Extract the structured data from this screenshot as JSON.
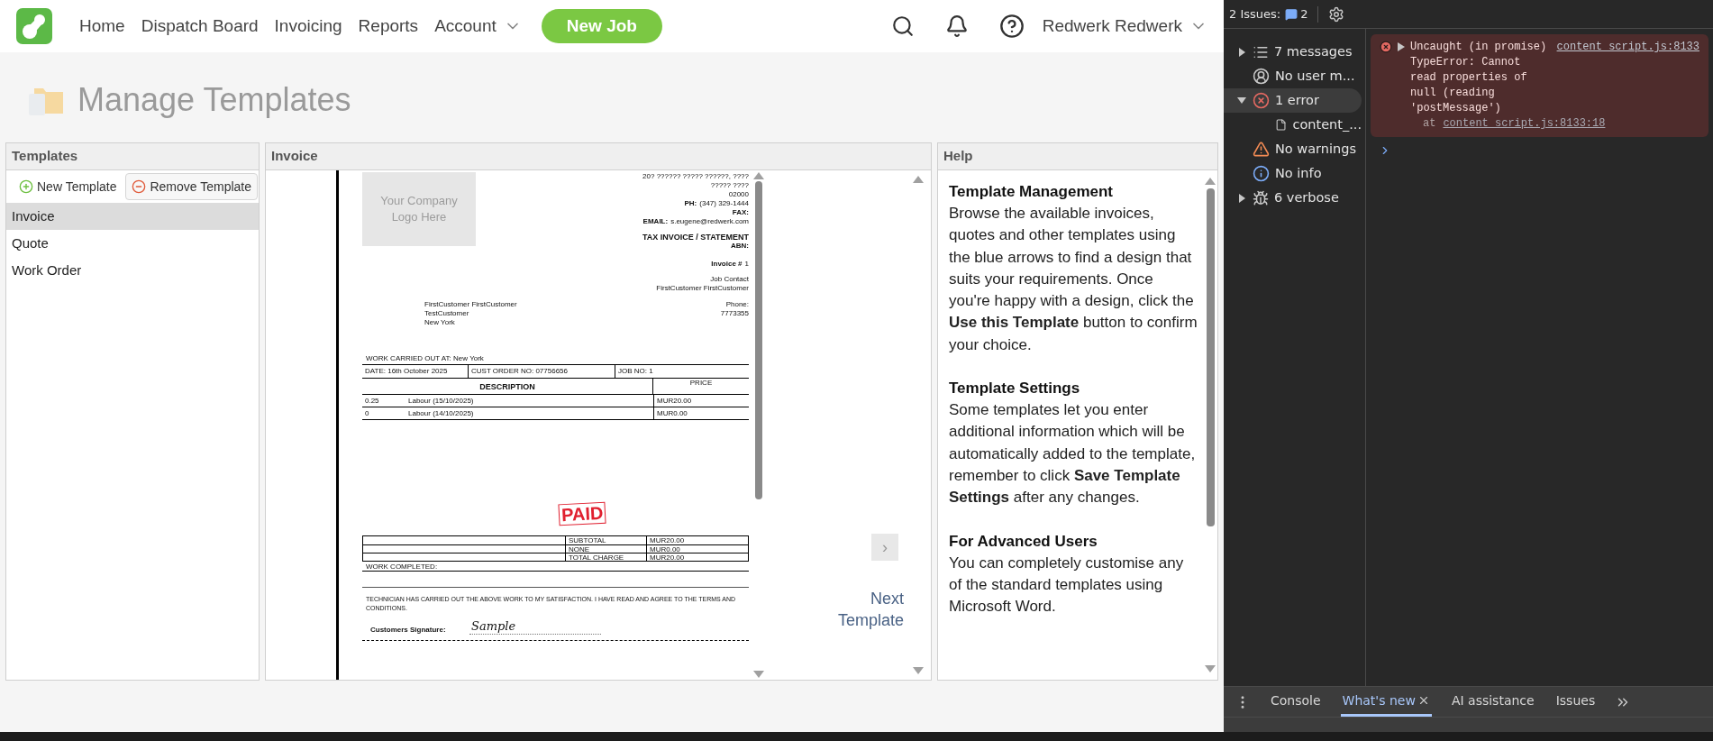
{
  "nav": {
    "items": [
      {
        "label": "Home",
        "dropdown": false
      },
      {
        "label": "Dispatch Board",
        "dropdown": false
      },
      {
        "label": "Invoicing",
        "dropdown": false
      },
      {
        "label": "Reports",
        "dropdown": false
      },
      {
        "label": "Account",
        "dropdown": true
      }
    ],
    "new_job": "New Job",
    "user": "Redwerk Redwerk"
  },
  "page_title": "Manage Templates",
  "templates_panel": {
    "title": "Templates",
    "toolbar": [
      {
        "label": "New Template",
        "kind": "add"
      },
      {
        "label": "Remove Template",
        "kind": "remove"
      }
    ],
    "items": [
      {
        "label": "Invoice",
        "selected": true
      },
      {
        "label": "Quote",
        "selected": false
      },
      {
        "label": "Work Order",
        "selected": false
      }
    ]
  },
  "invoice_panel": {
    "title": "Invoice",
    "next_template": "Next Template",
    "next_button": "›",
    "document": {
      "logo_placeholder": "Your Company Logo Here",
      "address_lines": [
        "20? ?????? ????? ??????, ????",
        "????? ????",
        "02000"
      ],
      "contact_fields": [
        {
          "label": "PH:",
          "value": "(347) 329-1444"
        },
        {
          "label": "FAX:"
        },
        {
          "label": "EMAIL:",
          "value": "s.eugene@redwerk.com"
        }
      ],
      "doc_title": "TAX INVOICE / STATEMENT",
      "abn": "ABN:",
      "invoice_label": "Invoice #",
      "invoice_number": "1",
      "job_contact_label": "Job Contact",
      "job_contact": "FirstCustomer FirstCustomer",
      "customer_lines": [
        "FirstCustomer FirstCustomer",
        "TestCustomer",
        "New York"
      ],
      "phone_label": "Phone:",
      "phone": "7773355",
      "work_location": "WORK CARRIED OUT AT: New York",
      "info_row": [
        "DATE: 16th October 2025",
        "CUST ORDER NO: 07756656",
        "JOB NO: 1"
      ],
      "columns": [
        "DESCRIPTION",
        "PRICE"
      ],
      "lines": [
        {
          "qty": "0.25",
          "description": "Labour (15/10/2025)",
          "price": "MUR20.00"
        },
        {
          "qty": "0",
          "description": "Labour (14/10/2025)",
          "price": "MUR0.00"
        }
      ],
      "stamp": "PAID",
      "totals": [
        {
          "label": "SUBTOTAL",
          "value": "MUR20.00"
        },
        {
          "label": "NONE",
          "value": "MUR0.00"
        },
        {
          "label": "TOTAL CHARGE",
          "value": "MUR20.00"
        }
      ],
      "work_completed": "WORK COMPLETED:",
      "terms": "TECHNICIAN HAS CARRIED OUT THE ABOVE WORK TO MY SATISFACTION. I HAVE READ AND AGREE TO THE TERMS AND CONDITIONS.",
      "signature_label": "Customers Signature:",
      "signature": "Sample"
    }
  },
  "help_panel": {
    "title": "Help",
    "sections": [
      {
        "heading": "Template Management",
        "text": "Browse the available invoices, quotes and other templates using the blue arrows to find a design that suits your requirements. Once you're happy with a design, click the **Use this Template** button to confirm your choice."
      },
      {
        "heading": "Template Settings",
        "text": "Some templates let you enter additional information which will be automatically added to the template, remember to click **Save Template Settings** after any changes."
      },
      {
        "heading": "For Advanced Users",
        "text": "You can completely customise any of the standard templates using Microsoft Word."
      }
    ]
  },
  "devtools": {
    "issues_label": "2 Issues:",
    "issues_count": "2",
    "sidebar": [
      {
        "label": "7 messages",
        "kind": "messages",
        "expanded": false,
        "selected": false
      },
      {
        "label": "No user m...",
        "kind": "user",
        "selected": false
      },
      {
        "label": "1 error",
        "kind": "error",
        "expanded": true,
        "selected": true,
        "children": [
          {
            "label": "content_...",
            "kind": "file",
            "selected": false
          }
        ]
      },
      {
        "label": "No warnings",
        "kind": "warning",
        "selected": false
      },
      {
        "label": "No info",
        "kind": "info",
        "selected": false
      },
      {
        "label": "6 verbose",
        "kind": "verbose",
        "expanded": false,
        "selected": false
      }
    ],
    "error": {
      "message": "Uncaught (in promise) TypeError: Cannot read properties of null (reading 'postMessage')",
      "source": "content_script.js:8133",
      "at": "at",
      "stack_link": "content_script.js:8133:18"
    },
    "tabs": [
      {
        "label": "Console",
        "selected": false,
        "closable": false
      },
      {
        "label": "What's new",
        "selected": true,
        "closable": true
      },
      {
        "label": "AI assistance",
        "selected": false,
        "closable": false
      },
      {
        "label": "Issues",
        "selected": false,
        "closable": false
      }
    ]
  }
}
